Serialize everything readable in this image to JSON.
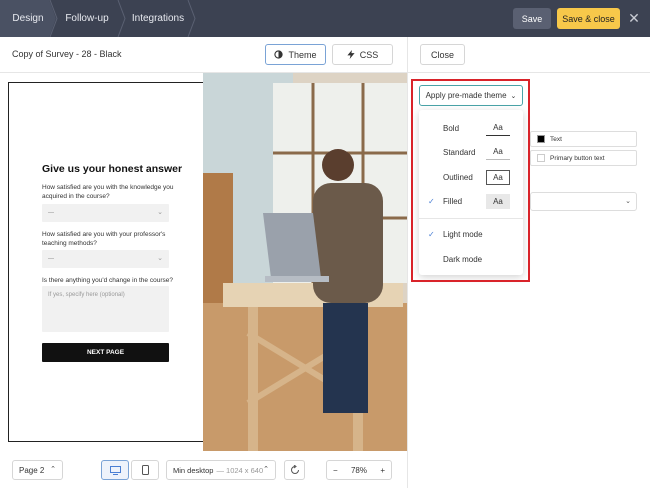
{
  "topbar": {
    "crumbs": [
      "Design",
      "Follow-up",
      "Integrations"
    ],
    "save_label": "Save",
    "save_close_label": "Save & close"
  },
  "subbar": {
    "survey_name": "Copy of Survey - 28 - Black",
    "theme_tab": "Theme",
    "css_tab": "CSS",
    "close_label": "Close"
  },
  "survey": {
    "title": "Give us your honest answer",
    "q1": "How satisfied are you with the knowledge you acquired in the course?",
    "q1_value": "---",
    "q2": "How satisfied are you with your professor's teaching methods?",
    "q2_value": "---",
    "q3": "Is there anything you'd change in the course?",
    "q3_placeholder": "If yes, specify here (optional)",
    "next_label": "NEXT PAGE"
  },
  "bottombar": {
    "page_label": "Page 2",
    "size_label": "Min desktop",
    "size_dim": "— 1024 x 640",
    "zoom_value": "78%",
    "zoom_minus": "−",
    "zoom_plus": "+"
  },
  "panel": {
    "apply_label": "Apply pre-made theme",
    "text_field": "Text",
    "primary_button_text": "Primary button text",
    "text_swatch_color": "#000000",
    "primary_swatch_color": "#ffffff"
  },
  "dropdown": {
    "items": [
      {
        "label": "Bold",
        "sample": "Aa",
        "checked": false
      },
      {
        "label": "Standard",
        "sample": "Aa",
        "checked": false
      },
      {
        "label": "Outlined",
        "sample": "Aa",
        "checked": false
      },
      {
        "label": "Filled",
        "sample": "Aa",
        "checked": true
      },
      {
        "label": "Light mode",
        "checked": true
      },
      {
        "label": "Dark mode",
        "checked": false
      }
    ]
  },
  "colors": {
    "topbar_bg": "#3c4252",
    "accent_yellow": "#f7c84a",
    "highlight_red": "#d9232a",
    "check_blue": "#4a7fd4"
  }
}
